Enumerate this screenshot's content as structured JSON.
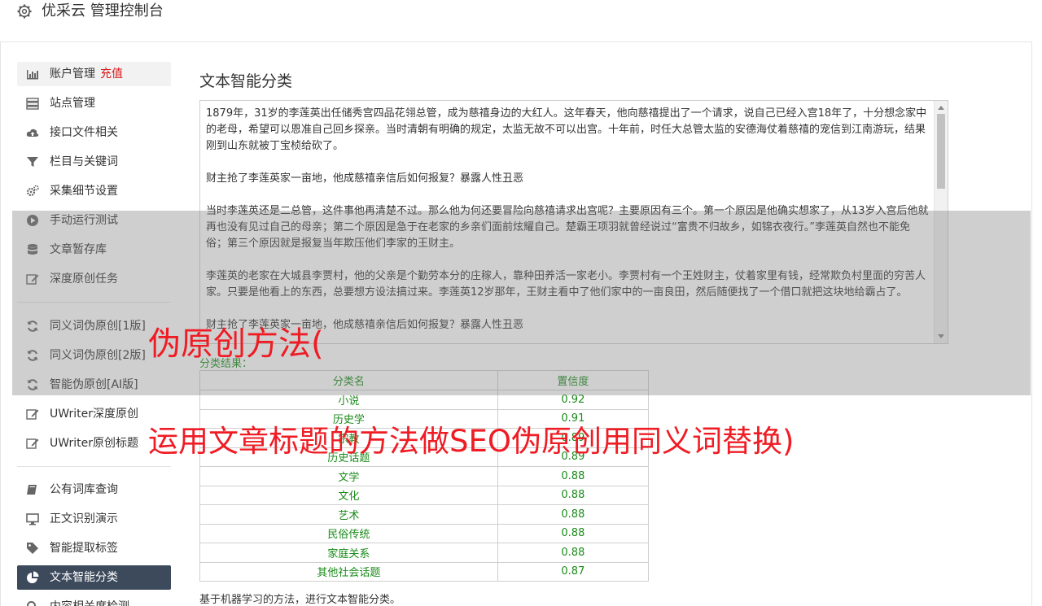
{
  "header": {
    "title": "优采云 管理控制台",
    "icon": "gear-icon"
  },
  "sidebar": {
    "items": [
      {
        "label": "账户管理",
        "badge": "充值",
        "icon": "bar-chart-icon"
      },
      {
        "label": "站点管理",
        "icon": "server-icon"
      },
      {
        "label": "接口文件相关",
        "icon": "cloud-upload-icon"
      },
      {
        "label": "栏目与关键词",
        "icon": "filter-icon"
      },
      {
        "label": "采集细节设置",
        "icon": "cogs-icon"
      },
      {
        "label": "手动运行测试",
        "icon": "play-circle-icon"
      },
      {
        "label": "文章暂存库",
        "icon": "database-icon"
      },
      {
        "label": "深度原创任务",
        "icon": "edit-icon"
      },
      {
        "label": "同义词伪原创[1版]",
        "icon": "refresh-icon"
      },
      {
        "label": "同义词伪原创[2版]",
        "icon": "refresh-icon"
      },
      {
        "label": "智能伪原创[AI版]",
        "icon": "refresh-icon"
      },
      {
        "label": "UWriter深度原创",
        "icon": "edit-icon"
      },
      {
        "label": "UWriter原创标题",
        "icon": "edit-icon"
      },
      {
        "label": "公有词库查询",
        "icon": "book-icon"
      },
      {
        "label": "正文识别演示",
        "icon": "monitor-icon"
      },
      {
        "label": "智能提取标签",
        "icon": "tag-icon"
      },
      {
        "label": "文本智能分类",
        "icon": "pie-chart-icon"
      },
      {
        "label": "内容相关度检测",
        "icon": "search-icon"
      }
    ]
  },
  "main": {
    "title": "文本智能分类",
    "text_paragraphs": [
      "1879年，31岁的李莲英出任储秀宫四品花翎总管，成为慈禧身边的大红人。这年春天，他向慈禧提出了一个请求，说自己已经入宫18年了，十分想念家中的老母，希望可以恩准自己回乡探亲。当时清朝有明确的规定，太监无故不可以出宫。十年前，时任大总管太监的安德海仗着慈禧的宠信到江南游玩，结果刚到山东就被丁宝桢给砍了。",
      "财主抢了李莲英家一亩地，他成慈禧亲信后如何报复？暴露人性丑恶",
      "当时李莲英还是二总管，这件事他再清楚不过。那么他为何还要冒险向慈禧请求出宫呢？主要原因有三个。第一个原因是他确实想家了，从13岁入宫后他就再也没有见过自己的母亲；第二个原因是急于在老家的乡亲们面前炫耀自己。楚霸王项羽就曾经说过“富贵不归故乡，如锦衣夜行。”李莲英自然也不能免俗；第三个原因就是报复当年欺压他们李家的王财主。",
      "李莲英的老家在大城县李贾村，他的父亲是个勤劳本分的庄稼人，靠种田养活一家老小。李贾村有一个王姓财主，仗着家里有钱，经常欺负村里面的穷苦人家。只要是他看上的东西，总要想方设法搞过来。李莲英12岁那年，王财主看中了他们家中的一亩良田，然后随便找了一个借口就把这块地给霸占了。",
      "财主抢了李莲英家一亩地，他成慈禧亲信后如何报复？暴露人性丑恶"
    ],
    "result_label": "分类结果：",
    "table": {
      "headers": [
        "分类名",
        "置信度"
      ],
      "rows": [
        [
          "小说",
          "0.92"
        ],
        [
          "历史学",
          "0.91"
        ],
        [
          "宗教",
          "0.89"
        ],
        [
          "历史话题",
          "0.89"
        ],
        [
          "文学",
          "0.88"
        ],
        [
          "文化",
          "0.88"
        ],
        [
          "艺术",
          "0.88"
        ],
        [
          "民俗传统",
          "0.88"
        ],
        [
          "家庭关系",
          "0.88"
        ],
        [
          "其他社会话题",
          "0.87"
        ]
      ]
    },
    "footnote": "基于机器学习的方法，进行文本智能分类。"
  },
  "overlay": {
    "line1": "伪原创方法(",
    "line2": "运用文章标题的方法做SEO伪原创用同义词替换)"
  },
  "colors": {
    "active_bg": "#3d4a5c",
    "badge": "#d9181a",
    "result_green": "#1a8a1a",
    "overlay_red": "#ef1c24"
  }
}
